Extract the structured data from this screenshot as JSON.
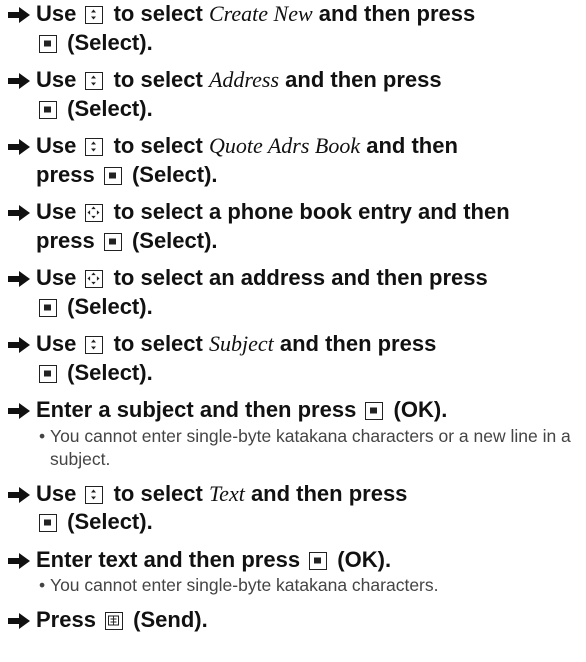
{
  "steps": [
    {
      "l1a": "Use ",
      "l1b": " to select ",
      "term": "Create New",
      "l1c": " and then press",
      "l2": " (Select)."
    },
    {
      "l1a": "Use ",
      "l1b": " to select ",
      "term": "Address",
      "l1c": " and then press",
      "l2": " (Select)."
    },
    {
      "l1a": "Use ",
      "l1b": " to select ",
      "term": "Quote Adrs Book",
      "l1c": " and then",
      "l2a": "press ",
      "l2": " (Select)."
    },
    {
      "l1a": "Use ",
      "l1b": " to select a phone book entry and then",
      "l2a": "press ",
      "l2": " (Select)."
    },
    {
      "l1a": "Use ",
      "l1b": " to select an address and then press",
      "l2": " (Select)."
    },
    {
      "l1a": "Use ",
      "l1b": " to select ",
      "term": "Subject",
      "l1c": " and then press",
      "l2": " (Select)."
    },
    {
      "l1a": "Enter a subject and then press ",
      "l1c": " (OK).",
      "note": "You cannot enter single-byte katakana characters or a new line in a subject."
    },
    {
      "l1a": "Use ",
      "l1b": " to select ",
      "term": "Text",
      "l1c": " and then press",
      "l2": " (Select)."
    },
    {
      "l1a": "Enter text and then press ",
      "l1c": " (OK).",
      "note": "You cannot enter single-byte katakana characters."
    },
    {
      "l1a": "Press ",
      "l1c": " (Send)."
    }
  ],
  "bullet_char": "•",
  "icons": {
    "arrow": "right-arrow-icon",
    "updown": "updown-navigation-key-icon",
    "multi": "multi-direction-navigation-key-icon",
    "center": "center-select-key-icon",
    "send": "send-key-icon"
  }
}
